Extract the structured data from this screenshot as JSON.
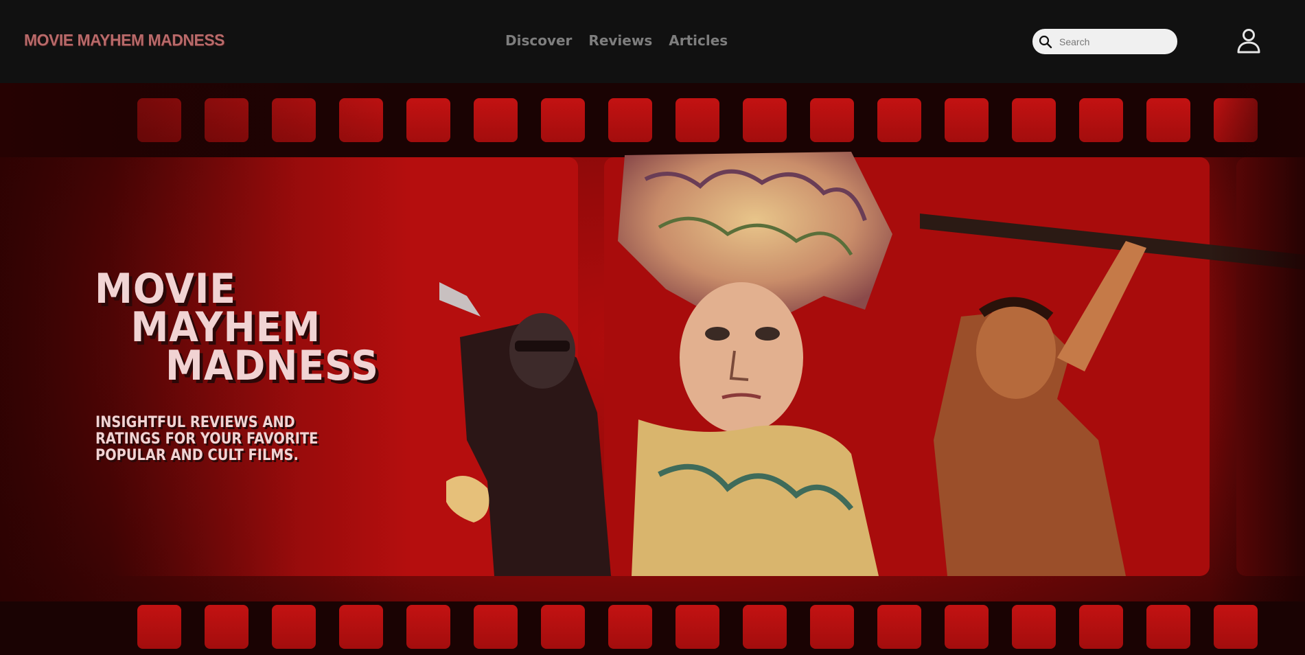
{
  "header": {
    "logo": "MOVIE MAYHEM MADNESS",
    "nav": [
      "Discover",
      "Reviews",
      "Articles"
    ],
    "search": {
      "placeholder": "Search",
      "value": ""
    },
    "icons": {
      "search": "search-icon",
      "user": "user-icon"
    }
  },
  "hero": {
    "title_lines": [
      "MOVIE",
      "MAYHEM",
      "MADNESS"
    ],
    "subtitle": "INSIGHTFUL REVIEWS AND RATINGS FOR YOUR FAVORITE POPULAR AND CULT FILMS."
  },
  "colors": {
    "background": "#111111",
    "hero_red": "#b20d0d",
    "film_strip": "#1a0303",
    "logo": "#b86a6a",
    "nav_text": "#7e7e7e",
    "hero_text": "#f1d3d3"
  }
}
